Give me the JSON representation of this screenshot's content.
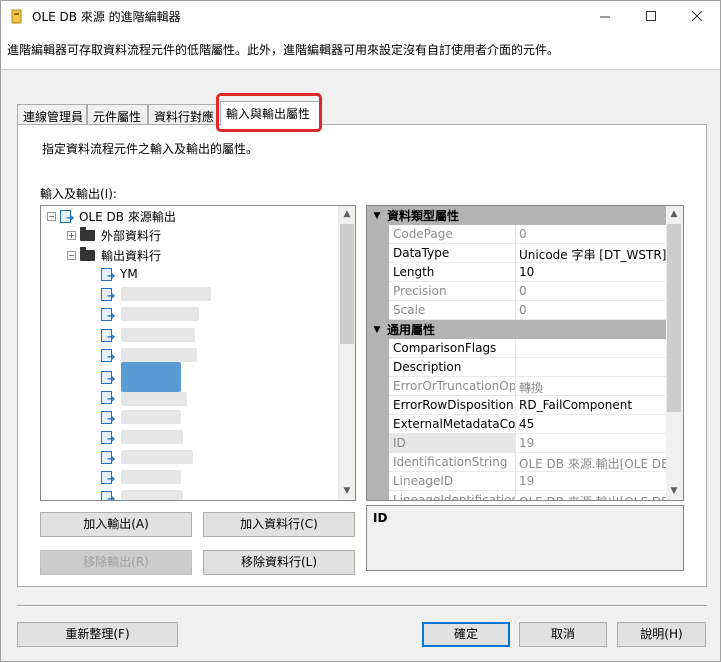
{
  "window": {
    "title": "OLE DB 來源 的進階編輯器",
    "description": "進階編輯器可存取資料流程元件的低階屬性。此外，進階編輯器可用來設定沒有自訂使用者介面的元件。"
  },
  "tabs": [
    "連線管理員",
    "元件屬性",
    "資料行對應",
    "輸入與輸出屬性"
  ],
  "panel": {
    "description": "指定資料流程元件之輸入及輸出的屬性。",
    "io_label": "輸入及輸出(I):"
  },
  "tree": {
    "root": "OLE DB 來源輸出",
    "external_columns": "外部資料行",
    "output_columns": "輸出資料行",
    "first_column": "YM"
  },
  "buttons": {
    "add_output": "加入輸出(A)",
    "add_column": "加入資料行(C)",
    "remove_output": "移除輸出(R)",
    "remove_column": "移除資料行(L)",
    "refresh": "重新整理(F)",
    "ok": "確定",
    "cancel": "取消",
    "help": "說明(H)"
  },
  "properties": {
    "cat1": "資料類型屬性",
    "cat2": "通用屬性",
    "rows1": [
      {
        "name": "CodePage",
        "value": "0",
        "ro": true
      },
      {
        "name": "DataType",
        "value": "Unicode 字串 [DT_WSTR]",
        "ro": false
      },
      {
        "name": "Length",
        "value": "10",
        "ro": false
      },
      {
        "name": "Precision",
        "value": "0",
        "ro": true
      },
      {
        "name": "Scale",
        "value": "0",
        "ro": true
      }
    ],
    "rows2": [
      {
        "name": "ComparisonFlags",
        "value": "",
        "ro": false
      },
      {
        "name": "Description",
        "value": "",
        "ro": false
      },
      {
        "name": "ErrorOrTruncationOpe",
        "value": "轉換",
        "ro": true
      },
      {
        "name": "ErrorRowDisposition",
        "value": "RD_FailComponent",
        "ro": false
      },
      {
        "name": "ExternalMetadataColu",
        "value": "45",
        "ro": false
      },
      {
        "name": "ID",
        "value": "19",
        "ro": true
      },
      {
        "name": "IdentificationString",
        "value": "OLE DB 來源.輸出[OLE DB",
        "ro": true
      },
      {
        "name": "LineageID",
        "value": "19",
        "ro": true
      },
      {
        "name": "LineageIdentificationS",
        "value": "OLE DB 來源.輸出[OLE DB",
        "ro": true
      }
    ],
    "description_title": "ID"
  }
}
